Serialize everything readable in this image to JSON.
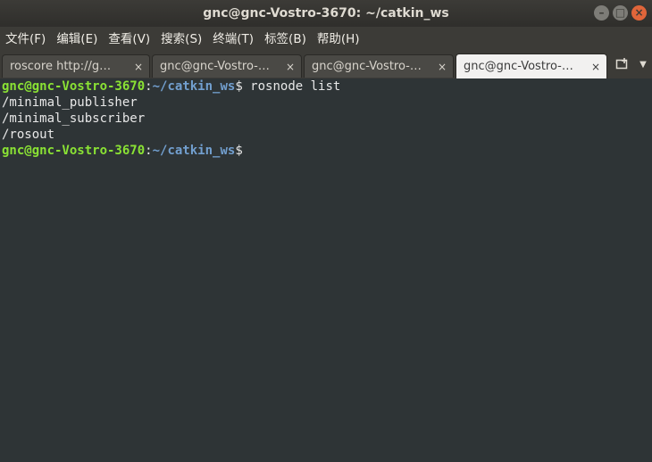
{
  "window": {
    "title": "gnc@gnc-Vostro-3670: ~/catkin_ws",
    "minimize_glyph": "–",
    "maximize_glyph": "□",
    "close_glyph": "×"
  },
  "menu": [
    "文件(F)",
    "编辑(E)",
    "查看(V)",
    "搜索(S)",
    "终端(T)",
    "标签(B)",
    "帮助(H)"
  ],
  "tabs": [
    {
      "label": "roscore http://g…",
      "active": false
    },
    {
      "label": "gnc@gnc-Vostro-…",
      "active": false
    },
    {
      "label": "gnc@gnc-Vostro-…",
      "active": false
    },
    {
      "label": "gnc@gnc-Vostro-…",
      "active": true
    }
  ],
  "tab_close_glyph": "×",
  "new_tab_icon": "new-tab-icon",
  "terminal": {
    "user_host": "gnc@gnc-Vostro-3670",
    "separator": ":",
    "path": "~/catkin_ws",
    "prompt_symbol": "$",
    "command": " rosnode list",
    "output": [
      "/minimal_publisher",
      "/minimal_subscriber",
      "/rosout"
    ],
    "trailing": " "
  }
}
